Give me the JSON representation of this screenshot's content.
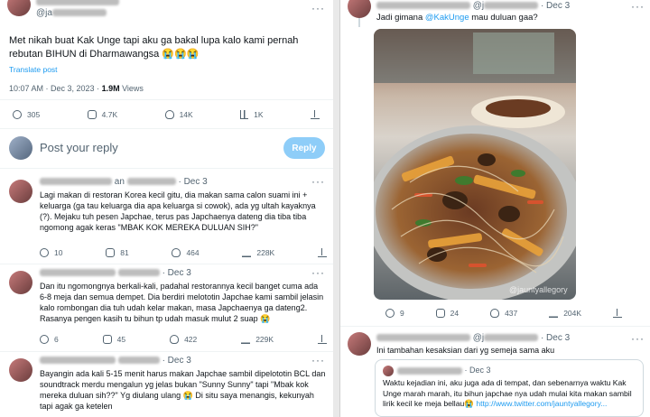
{
  "main_tweet": {
    "handle": "@ja",
    "text": "Met nikah buat Kak Unge tapi aku ga bakal lupa kalo kami pernah rebutan BIHUN di Dharmawangsa 😭😭😭",
    "translate": "Translate post",
    "time": "10:07 AM · Dec 3, 2023 · ",
    "views_num": "1.9M",
    "views_label": " Views",
    "stats": {
      "replies": "305",
      "reposts": "4.7K",
      "likes": "14K",
      "bookmarks": "1K"
    }
  },
  "composer": {
    "placeholder": "Post your reply",
    "button": "Reply"
  },
  "left_replies": [
    {
      "date": "· Dec 3",
      "text": "Lagi makan di restoran Korea kecil gitu, dia makan sama calon suami ini + keluarga (ga tau keluarga dia apa keluarga si cowok), ada yg ultah kayaknya (?). Mejaku tuh pesen Japchae, terus pas Japchaenya dateng dia tiba tiba ngomong agak keras \"MBAK KOK MEREKA DULUAN SIH?\"",
      "replies": "10",
      "reposts": "81",
      "likes": "464",
      "views": "228K"
    },
    {
      "date": "· Dec 3",
      "text": "Dan itu ngomongnya berkali-kali, padahal restorannya kecil banget cuma ada 6-8 meja dan semua dempet. Dia berdiri melototin Japchae kami sambil jelasin kalo rombongan dia tuh udah kelar makan, masa Japchaenya ga dateng2. Rasanya pengen kasih tu bihun tp udah masuk mulut 2 suap 😭",
      "replies": "6",
      "reposts": "45",
      "likes": "422",
      "views": "229K"
    },
    {
      "date": "· Dec 3",
      "text": "Bayangin ada kali 5-15 menit harus makan Japchae sambil dipelototin BCL dan soundtrack merdu mengalun yg jelas bukan \"Sunny Sunny\" tapi \"Mbak kok mereka duluan sih??\" Yg diulang ulang 😭 Di situ saya menangis, kekunyah tapi agak ga ketelen"
    }
  ],
  "right_tweet": {
    "handle": "@j",
    "date": "· Dec 3",
    "text_prefix": "Jadi gimana ",
    "mention": "@KakUnge",
    "text_suffix": " mau duluan gaa?",
    "stats": {
      "replies": "9",
      "reposts": "24",
      "likes": "437",
      "views": "204K"
    }
  },
  "right_reply": {
    "handle": "@j",
    "date": "· Dec 3",
    "text": "Ini tambahan kesaksian dari yg semeja sama aku",
    "quote": {
      "date": "· Dec 3",
      "text": "Waktu kejadian ini, aku juga ada di tempat, dan sebenarnya waktu Kak Unge marah marah, itu bihun japchae nya udah mulai kita makan sambil lirik kecil ke meja bellau😭 ",
      "link": "http://www.twitter.com/jauntyallegory..."
    }
  },
  "watermark": "@jauntyallegory",
  "colors": {
    "accent": "#1d9bf0",
    "muted": "#536471"
  }
}
